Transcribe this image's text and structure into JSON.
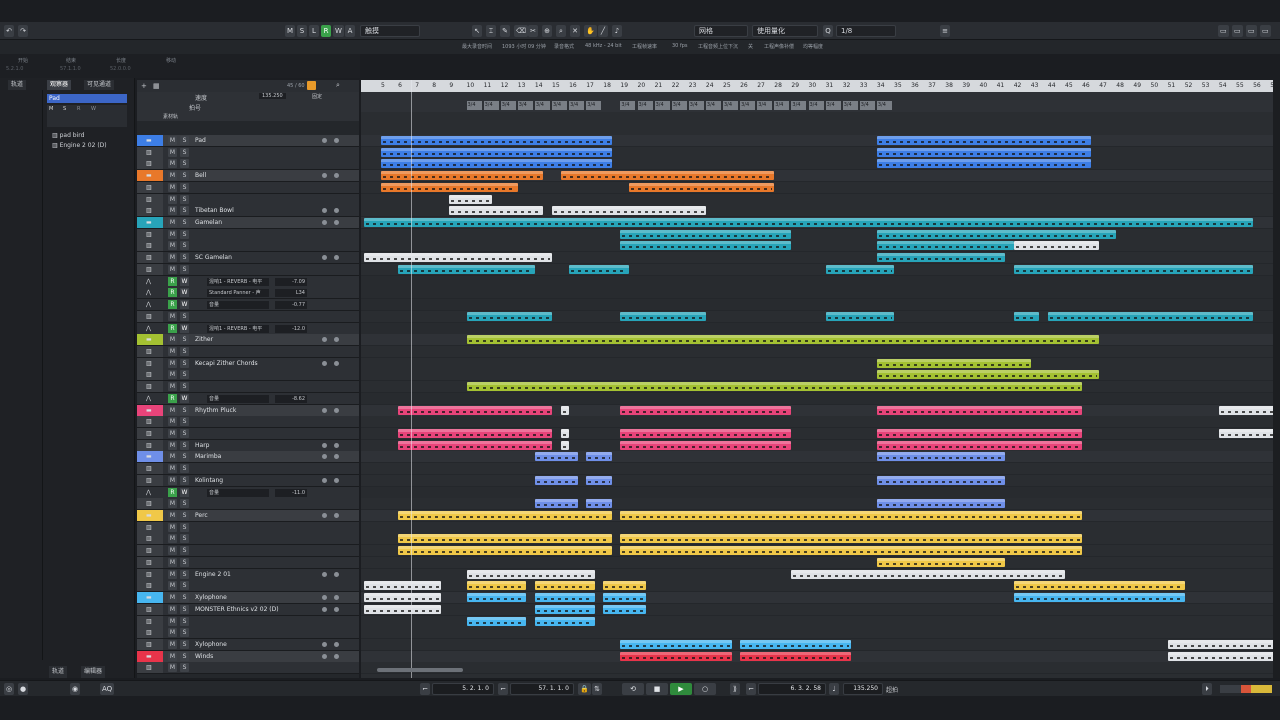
{
  "toolbar": {
    "undo_icon": "undo-icon",
    "redo_icon": "redo-icon",
    "mode_buttons": [
      "M",
      "S",
      "L",
      "R",
      "W",
      "A"
    ],
    "automation_mode": "触摸",
    "snap_type": "网格",
    "quantize_type": "使用量化",
    "quantize_value": "1/8"
  },
  "status": {
    "items": [
      {
        "label": "最大录音时间",
        "value": ""
      },
      {
        "label": "",
        "value": "1093 小时 09 分钟"
      },
      {
        "label": "录音格式",
        "value": ""
      },
      {
        "label": "",
        "value": "48 kHz - 24 bit"
      },
      {
        "label": "工程帧速率",
        "value": ""
      },
      {
        "label": "",
        "value": "30 fps"
      },
      {
        "label": "工程音频上位下沉",
        "value": ""
      },
      {
        "label": "",
        "value": "关"
      },
      {
        "label": "工程声像补偿",
        "value": ""
      },
      {
        "label": "",
        "value": "均等幅度"
      }
    ]
  },
  "transport_info": {
    "labels": [
      "开始",
      "结束",
      "长度",
      "移动"
    ],
    "values": [
      "5.2.1.0",
      "57.1.1.0",
      "52.0.0.0",
      ""
    ]
  },
  "left_zone": {
    "tabs": [
      "观察器",
      "可见通道"
    ],
    "left_tab": "轨道",
    "track_name": "Pad",
    "instruments": [
      "pad bird",
      "Engine 2 02 (D)"
    ],
    "bottom_tabs": [
      "轨道",
      "编辑器"
    ]
  },
  "track_header": {
    "tempo_label": "速度",
    "tempo_value": "135.250",
    "tempo_mode": "固定",
    "signature_label": "拍号",
    "marker_label": "素材轨",
    "count": "45 / 60"
  },
  "tracks": [
    {
      "name": "Pad",
      "kind": "folder",
      "color": "#3d7ee6"
    },
    {
      "name": "",
      "kind": "inst",
      "color": "#3d7ee6"
    },
    {
      "name": "",
      "kind": "inst",
      "color": "#3d7ee6"
    },
    {
      "name": "Bell",
      "kind": "folder",
      "color": "#e8782a"
    },
    {
      "name": "",
      "kind": "inst",
      "color": "#e8782a"
    },
    {
      "name": "",
      "kind": "inst",
      "color": "#e8782a"
    },
    {
      "name": "Tibetan Bowl",
      "kind": "inst",
      "color": "#e8782a"
    },
    {
      "name": "Gamelan",
      "kind": "folder",
      "color": "#27a4b9"
    },
    {
      "name": "",
      "kind": "inst",
      "color": "#27a4b9"
    },
    {
      "name": "",
      "kind": "inst",
      "color": "#27a4b9"
    },
    {
      "name": "SC Gamelan",
      "kind": "inst",
      "color": "#27a4b9"
    },
    {
      "name": "",
      "kind": "inst",
      "color": "#27a4b9"
    },
    {
      "name": "混响1 - REVERB - 电平",
      "kind": "auto",
      "value": "-7.09"
    },
    {
      "name": "Standard Panner - 声",
      "kind": "auto",
      "value": "L34"
    },
    {
      "name": "音量",
      "kind": "auto",
      "value": "-0.77"
    },
    {
      "name": "",
      "kind": "inst",
      "color": "#27a4b9"
    },
    {
      "name": "混响1 - REVERB - 电平",
      "kind": "auto",
      "value": "-12.0"
    },
    {
      "name": "Zither",
      "kind": "folder",
      "color": "#a4c132"
    },
    {
      "name": "",
      "kind": "inst",
      "color": "#a4c132"
    },
    {
      "name": "Kecapi Zither Chords",
      "kind": "inst",
      "color": "#a4c132"
    },
    {
      "name": "",
      "kind": "inst",
      "color": "#a4c132"
    },
    {
      "name": "",
      "kind": "inst",
      "color": "#a4c132"
    },
    {
      "name": "音量",
      "kind": "auto",
      "value": "-8.62"
    },
    {
      "name": "Rhythm Pluck",
      "kind": "folder",
      "color": "#e8447a"
    },
    {
      "name": "",
      "kind": "inst",
      "color": "#e8447a"
    },
    {
      "name": "",
      "kind": "inst",
      "color": "#e8447a"
    },
    {
      "name": "Harp",
      "kind": "inst",
      "color": "#e8447a"
    },
    {
      "name": "Marimba",
      "kind": "folder",
      "color": "#6f8fe8"
    },
    {
      "name": "",
      "kind": "inst",
      "color": "#6f8fe8"
    },
    {
      "name": "Kolintang",
      "kind": "inst",
      "color": "#6f8fe8"
    },
    {
      "name": "音量",
      "kind": "auto",
      "value": "-11.0"
    },
    {
      "name": "",
      "kind": "inst",
      "color": "#6f8fe8"
    },
    {
      "name": "Perc",
      "kind": "folder",
      "color": "#f0c848"
    },
    {
      "name": "",
      "kind": "inst",
      "color": "#f0c848"
    },
    {
      "name": "",
      "kind": "inst",
      "color": "#f0c848"
    },
    {
      "name": "",
      "kind": "inst",
      "color": "#f0c848"
    },
    {
      "name": "",
      "kind": "inst",
      "color": "#f0c848"
    },
    {
      "name": "Engine 2 01",
      "kind": "inst",
      "color": "#f0c848"
    },
    {
      "name": "",
      "kind": "inst",
      "color": "#f0c848"
    },
    {
      "name": "Xylophone",
      "kind": "folder",
      "color": "#47b6f0"
    },
    {
      "name": "MONSTER Ethnics v2 02 (D)",
      "kind": "inst",
      "color": "#47b6f0"
    },
    {
      "name": "",
      "kind": "inst",
      "color": "#47b6f0"
    },
    {
      "name": "",
      "kind": "inst",
      "color": "#47b6f0"
    },
    {
      "name": "Xylophone",
      "kind": "inst",
      "color": "#47b6f0"
    },
    {
      "name": "Winds",
      "kind": "folder",
      "color": "#e8344a"
    },
    {
      "name": "",
      "kind": "inst",
      "color": "#e8344a"
    }
  ],
  "ruler": {
    "bars": [
      "5",
      "6",
      "7",
      "8",
      "9",
      "10",
      "11",
      "12",
      "13",
      "14",
      "15",
      "16",
      "17",
      "18",
      "19",
      "20",
      "21",
      "22",
      "23",
      "24",
      "25",
      "26",
      "27",
      "28",
      "29",
      "30",
      "31",
      "32",
      "33",
      "34",
      "35",
      "36",
      "37",
      "38",
      "39",
      "40",
      "41",
      "42",
      "43",
      "44",
      "45",
      "46",
      "47",
      "48",
      "49",
      "50",
      "51",
      "52",
      "53",
      "54",
      "55",
      "56",
      "57",
      "58",
      "59"
    ],
    "signature": "3/4"
  },
  "transport": {
    "left_locator": "5. 2. 1. 0",
    "right_locator": "57. 1. 1. 0",
    "position": "6. 3. 2. 58",
    "tempo": "135.250",
    "sync": "超拍",
    "aq": "AQ"
  }
}
